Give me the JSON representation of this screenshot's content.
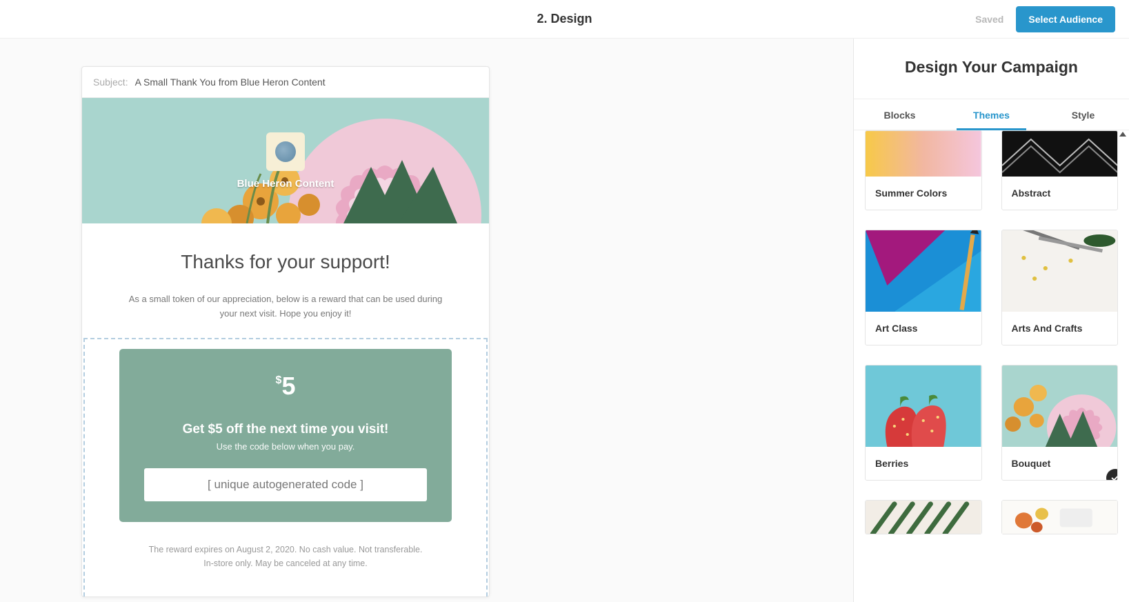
{
  "header": {
    "step_title": "2. Design",
    "saved": "Saved",
    "primary_action": "Select Audience"
  },
  "email": {
    "subject_label": "Subject:",
    "subject_value": "A Small Thank You from Blue Heron Content",
    "brand_name": "Blue Heron Content",
    "headline": "Thanks for your support!",
    "intro": "As a small token of our appreciation, below is a reward that can be used during your next visit. Hope you enjoy it!",
    "coupon": {
      "currency": "$",
      "amount": "5",
      "title": "Get $5 off the next time you visit!",
      "subtitle": "Use the code below when you pay.",
      "code_placeholder": "[ unique autogenerated code ]"
    },
    "fine_print_line1": "The reward expires on August 2, 2020. No cash value. Not transferable.",
    "fine_print_line2": "In-store only. May be canceled at any time."
  },
  "sidebar": {
    "title": "Design Your Campaign",
    "tabs": [
      {
        "label": "Blocks",
        "active": false
      },
      {
        "label": "Themes",
        "active": true
      },
      {
        "label": "Style",
        "active": false
      }
    ],
    "themes": [
      {
        "name": "Summer Colors",
        "selected": false
      },
      {
        "name": "Abstract",
        "selected": false
      },
      {
        "name": "Art Class",
        "selected": false
      },
      {
        "name": "Arts And Crafts",
        "selected": false
      },
      {
        "name": "Berries",
        "selected": false
      },
      {
        "name": "Bouquet",
        "selected": true
      }
    ]
  }
}
